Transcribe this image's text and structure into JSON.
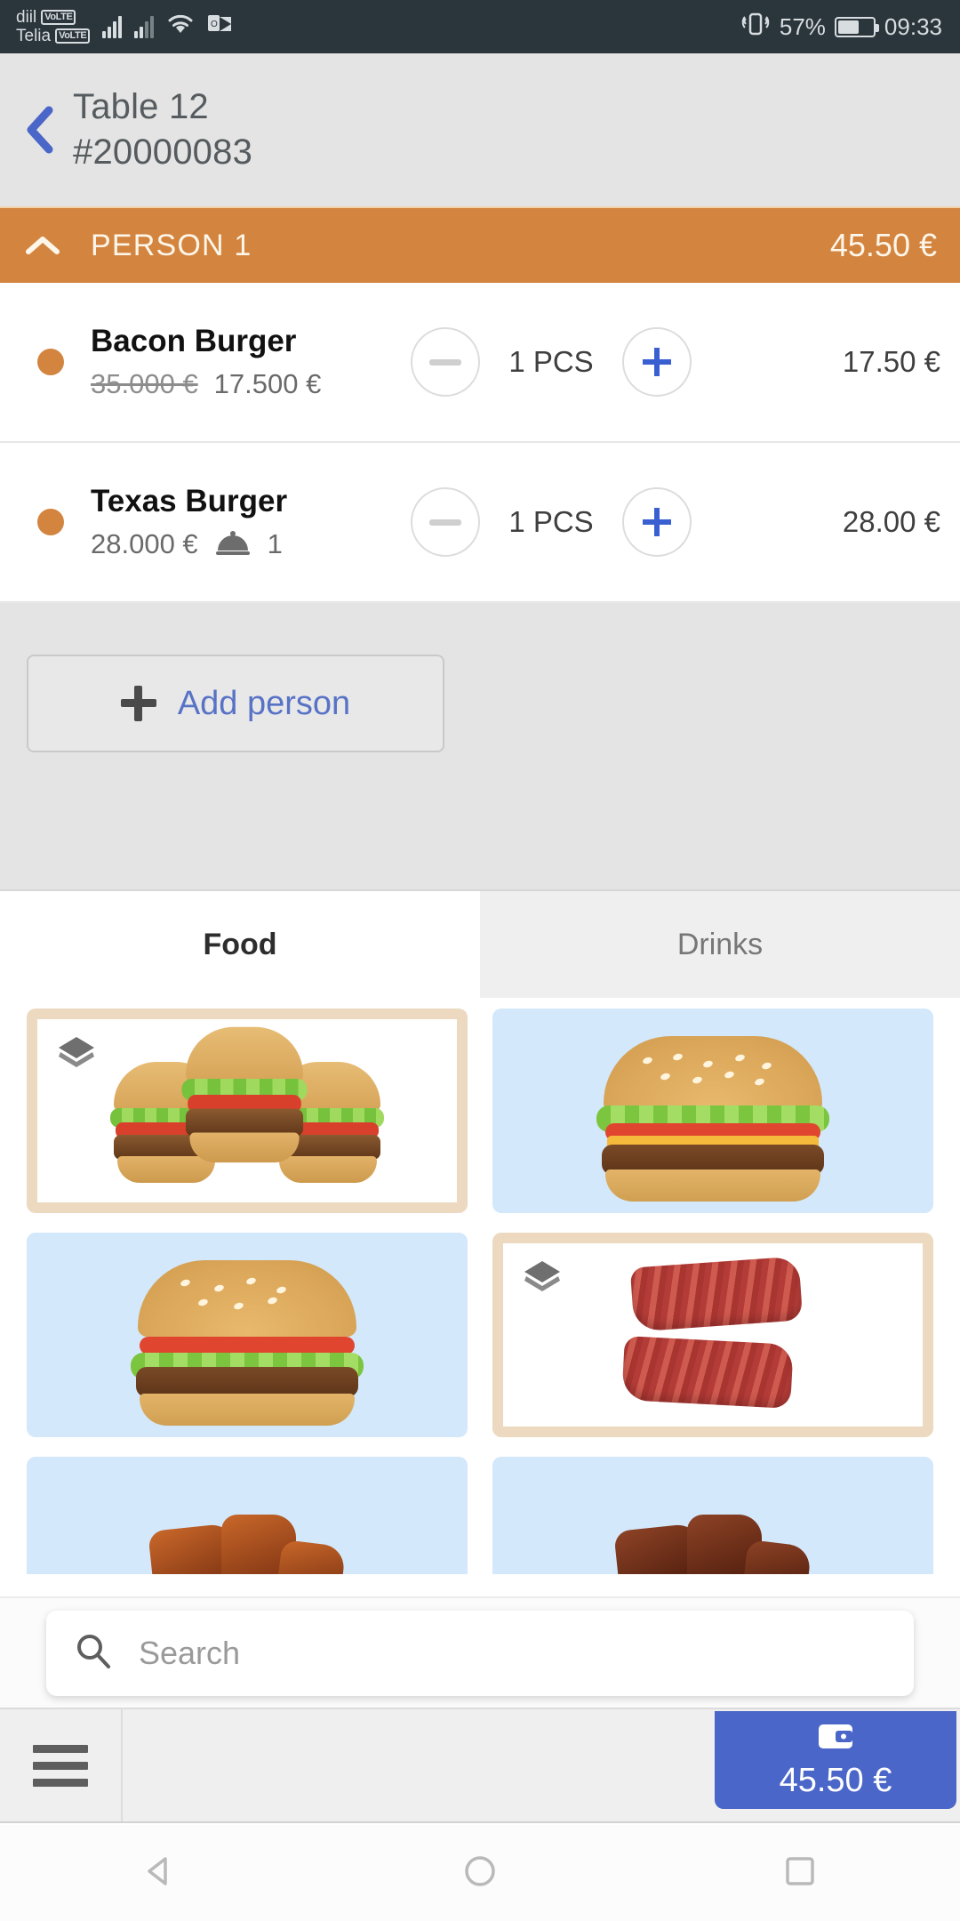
{
  "status_bar": {
    "carriers": [
      {
        "name": "diil",
        "volte": "VoLTE"
      },
      {
        "name": "Telia",
        "volte": "VoLTE"
      }
    ],
    "icons": [
      "signal-bars-icon",
      "signal-bars-icon",
      "wifi-icon",
      "outlook-icon",
      "vibrate-icon"
    ],
    "battery_percent": "57%",
    "time": "09:33"
  },
  "header": {
    "back_icon": "back-chevron-icon",
    "title": "Table 12",
    "order_number": "#20000083"
  },
  "person": {
    "collapse_icon": "chevron-up-icon",
    "label": "PERSON 1",
    "total": "45.50 €",
    "color": "#d3843f"
  },
  "order_items": [
    {
      "name": "Bacon Burger",
      "old_price": "35.000 €",
      "price": "17.500 €",
      "has_course_icon": false,
      "course": "",
      "minus_label": "decrease-quantity",
      "quantity": "1 PCS",
      "plus_label": "increase-quantity",
      "line_total": "17.50 €"
    },
    {
      "name": "Texas Burger",
      "old_price": "",
      "price": "28.000 €",
      "has_course_icon": true,
      "course": "1",
      "minus_label": "decrease-quantity",
      "quantity": "1 PCS",
      "plus_label": "increase-quantity",
      "line_total": "28.00 €"
    }
  ],
  "add_person": {
    "label": "Add person",
    "icon": "plus-icon"
  },
  "tabs": [
    {
      "label": "Food",
      "active": true
    },
    {
      "label": "Drinks",
      "active": false
    }
  ],
  "products": [
    {
      "name": "burgers-category",
      "type": "category",
      "art": "triple-burger"
    },
    {
      "name": "cheeseburger-product",
      "type": "product",
      "art": "burger"
    },
    {
      "name": "beef-burger-product",
      "type": "product",
      "art": "burger"
    },
    {
      "name": "steak-category",
      "type": "category",
      "art": "steak"
    },
    {
      "name": "ribs-product",
      "type": "product",
      "art": "ribs"
    },
    {
      "name": "roast-product",
      "type": "product",
      "art": "ribs-dark"
    }
  ],
  "search": {
    "icon": "search-icon",
    "placeholder": "Search",
    "value": ""
  },
  "bottom_bar": {
    "menu_icon": "hamburger-menu-icon",
    "pay_icon": "wallet-icon",
    "pay_amount": "45.50 €",
    "pay_color": "#4a66c8"
  },
  "nav_bar": {
    "back": "nav-back-icon",
    "home": "nav-home-icon",
    "recents": "nav-recents-icon"
  }
}
